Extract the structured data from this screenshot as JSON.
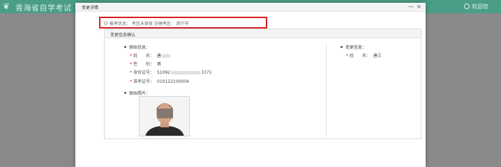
{
  "app": {
    "title": "青海省自学考试",
    "user_label": "欢迎您"
  },
  "modal": {
    "title": "变更详情",
    "minimize_glyph": "—",
    "close_glyph": "×",
    "exam_info": "报考状态： 考区未审核  办理考区： 西宁市",
    "panel_title": "变更信息确认",
    "original": {
      "section_label": "原始信息：",
      "name_label": "姓　　名：",
      "name_value": "唐",
      "gender_label": "性　　别：",
      "gender_value": "男",
      "id_label": "身份证号：",
      "id_prefix": "51092",
      "id_suffix": "3375",
      "exam_no_label": "准考证号：",
      "exam_no_value": "010122100004",
      "photo_label": "原始照片："
    },
    "change": {
      "section_label": "变更信息：",
      "name_label": "姓　　名：",
      "name_value": "唐三"
    }
  },
  "colors": {
    "header_bg": "#4a9d86",
    "overlay_bg": "#8a8a8a",
    "highlight_border": "#d62020",
    "required_mark": "#d62020"
  },
  "icons": [
    "logo-icon",
    "user-icon",
    "minimize-icon",
    "close-icon"
  ]
}
